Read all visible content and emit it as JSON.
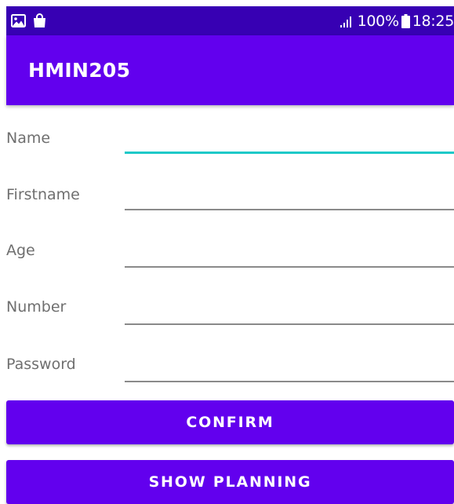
{
  "status_bar": {
    "left_icons": [
      "image-icon",
      "shopping-bag-icon"
    ],
    "signal_icon": "signal-icon",
    "battery_percent": "100%",
    "battery_icon": "battery-icon",
    "time": "18:25",
    "background_color": "#3700b3"
  },
  "app_bar": {
    "title": "HMIN205",
    "background_color": "#6200ee"
  },
  "form": {
    "fields": [
      {
        "label": "Name",
        "value": "",
        "focused": true
      },
      {
        "label": "Firstname",
        "value": ""
      },
      {
        "label": "Age",
        "value": ""
      },
      {
        "label": "Number",
        "value": ""
      },
      {
        "label": "Password",
        "value": ""
      }
    ],
    "focus_color": "#1ec9c8"
  },
  "buttons": {
    "confirm_label": "CONFIRM",
    "show_planning_label": "SHOW PLANNING",
    "color": "#6200ee"
  }
}
